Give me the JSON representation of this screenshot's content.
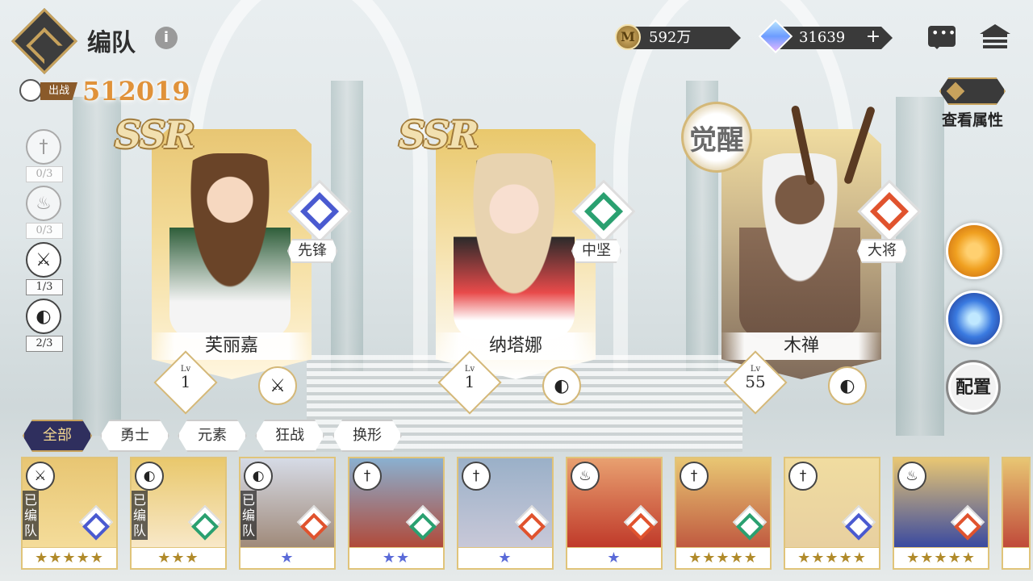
{
  "header": {
    "title": "编队",
    "gold": "592万",
    "gems": "31639"
  },
  "power": {
    "label": "出战",
    "value": "512019"
  },
  "class_counters": [
    {
      "icon": "sword-icon",
      "count": "0/3"
    },
    {
      "icon": "flame-icon",
      "count": "0/3"
    },
    {
      "icon": "axe-icon",
      "count": "1/3"
    },
    {
      "icon": "mask-icon",
      "count": "2/3"
    }
  ],
  "heroes": [
    {
      "rarity": "SSR",
      "name": "芙丽嘉",
      "role": "先锋",
      "role_color": "#4a5ad0",
      "level_label": "Lv",
      "level": "1",
      "class_icon": "axe-icon"
    },
    {
      "rarity": "SSR",
      "name": "纳塔娜",
      "role": "中坚",
      "role_color": "#2aa070",
      "level_label": "Lv",
      "level": "1",
      "class_icon": "mask-icon"
    },
    {
      "awaken": "觉醒",
      "name": "木禅",
      "role": "大将",
      "role_color": "#e0532e",
      "level_label": "Lv",
      "level": "55",
      "class_icon": "mask-icon"
    }
  ],
  "side": {
    "view_attributes": "查看属性",
    "config": "配置"
  },
  "filters": [
    "全部",
    "勇士",
    "元素",
    "狂战",
    "换形"
  ],
  "roster": [
    {
      "assigned": "已编队",
      "stars": "★★★★★",
      "class_icon": "axe-icon",
      "role": "blue"
    },
    {
      "assigned": "已编队",
      "stars": "★★★",
      "class_icon": "mask-icon",
      "role": "green"
    },
    {
      "assigned": "已编队",
      "stars": "★",
      "class_icon": "mask-icon",
      "role": "red"
    },
    {
      "assigned": "",
      "stars": "★★",
      "class_icon": "sword-icon",
      "role": "green"
    },
    {
      "assigned": "",
      "stars": "★",
      "class_icon": "sword-icon",
      "role": "red"
    },
    {
      "assigned": "",
      "stars": "★",
      "class_icon": "flame-icon",
      "role": "red"
    },
    {
      "assigned": "",
      "stars": "★★★★★",
      "class_icon": "sword-icon",
      "role": "green"
    },
    {
      "assigned": "",
      "stars": "★★★★★",
      "class_icon": "sword-icon",
      "role": "blue"
    },
    {
      "assigned": "",
      "stars": "★★★★★",
      "class_icon": "flame-icon",
      "role": "red"
    },
    {
      "assigned": "",
      "stars": "★",
      "class_icon": "",
      "role": ""
    }
  ]
}
